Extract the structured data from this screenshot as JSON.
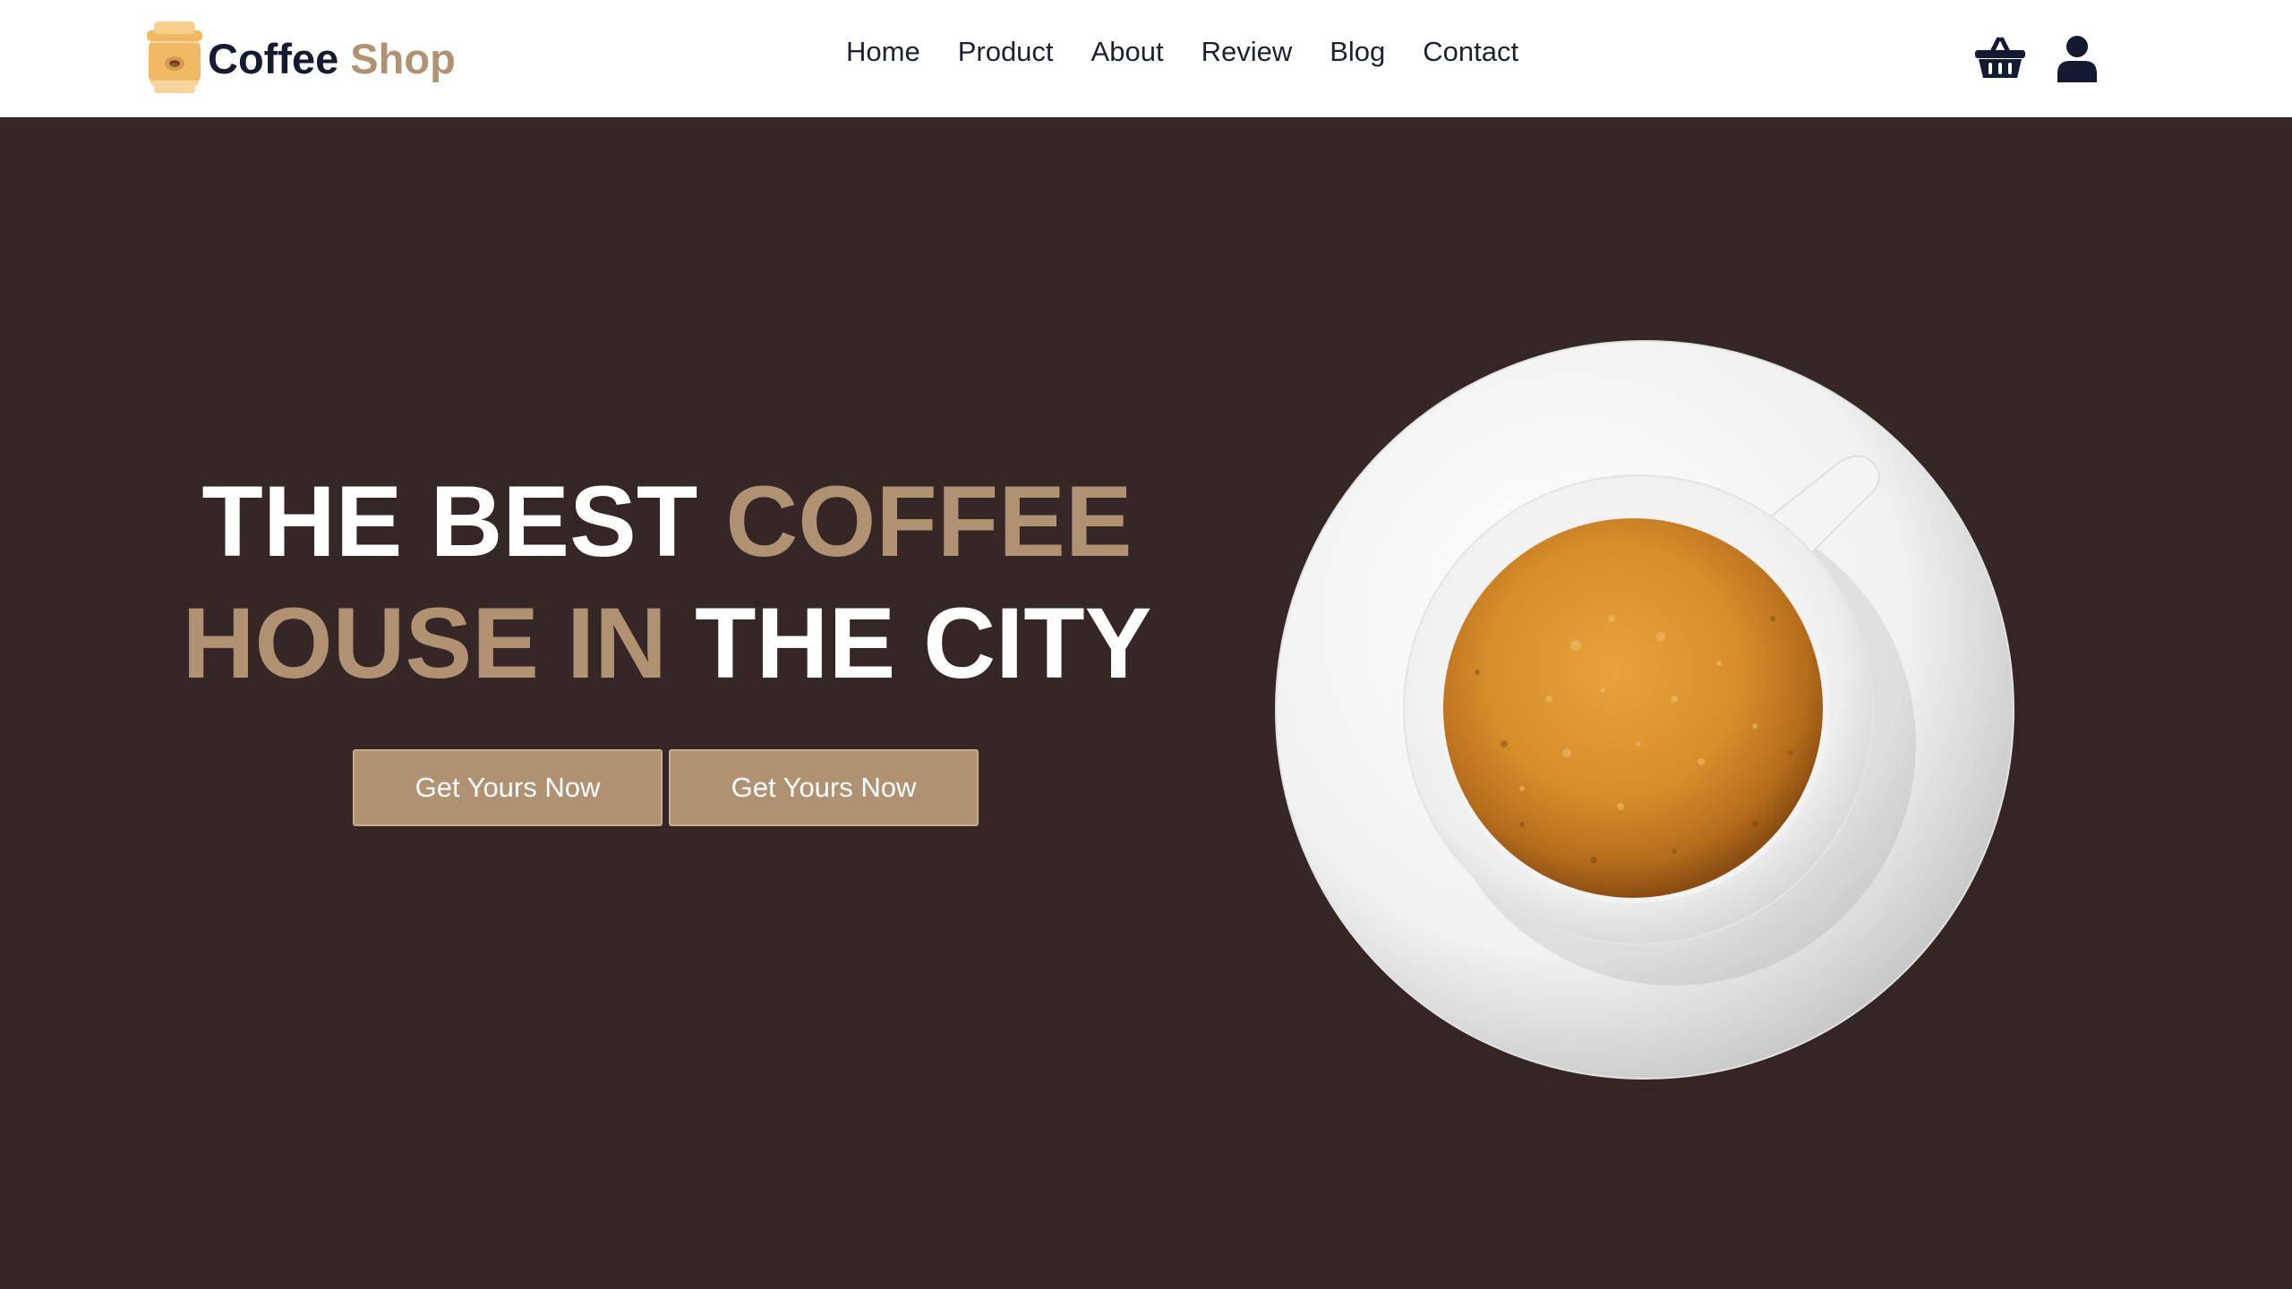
{
  "brand": {
    "name_part1": "Coffee",
    "name_part2": "Shop",
    "logo_icon": "coffee-cup-logo-icon",
    "color_dark": "#141a30",
    "color_accent": "#b09272"
  },
  "nav": {
    "items": [
      {
        "label": "Home"
      },
      {
        "label": "Product"
      },
      {
        "label": "About"
      },
      {
        "label": "Review"
      },
      {
        "label": "Blog"
      },
      {
        "label": "Contact"
      }
    ],
    "icons": [
      "shopping-basket-icon",
      "user-icon"
    ]
  },
  "hero": {
    "line1_a": "THE BEST",
    "line1_b": "COFFEE",
    "line2_a": "HOUSE IN",
    "line2_b": "THE CITY",
    "buttons": [
      {
        "label": "Get Yours Now"
      },
      {
        "label": "Get Yours Now"
      }
    ],
    "image": "coffee-cup-on-saucer",
    "background_color": "#352725",
    "accent_color": "#b09272"
  }
}
